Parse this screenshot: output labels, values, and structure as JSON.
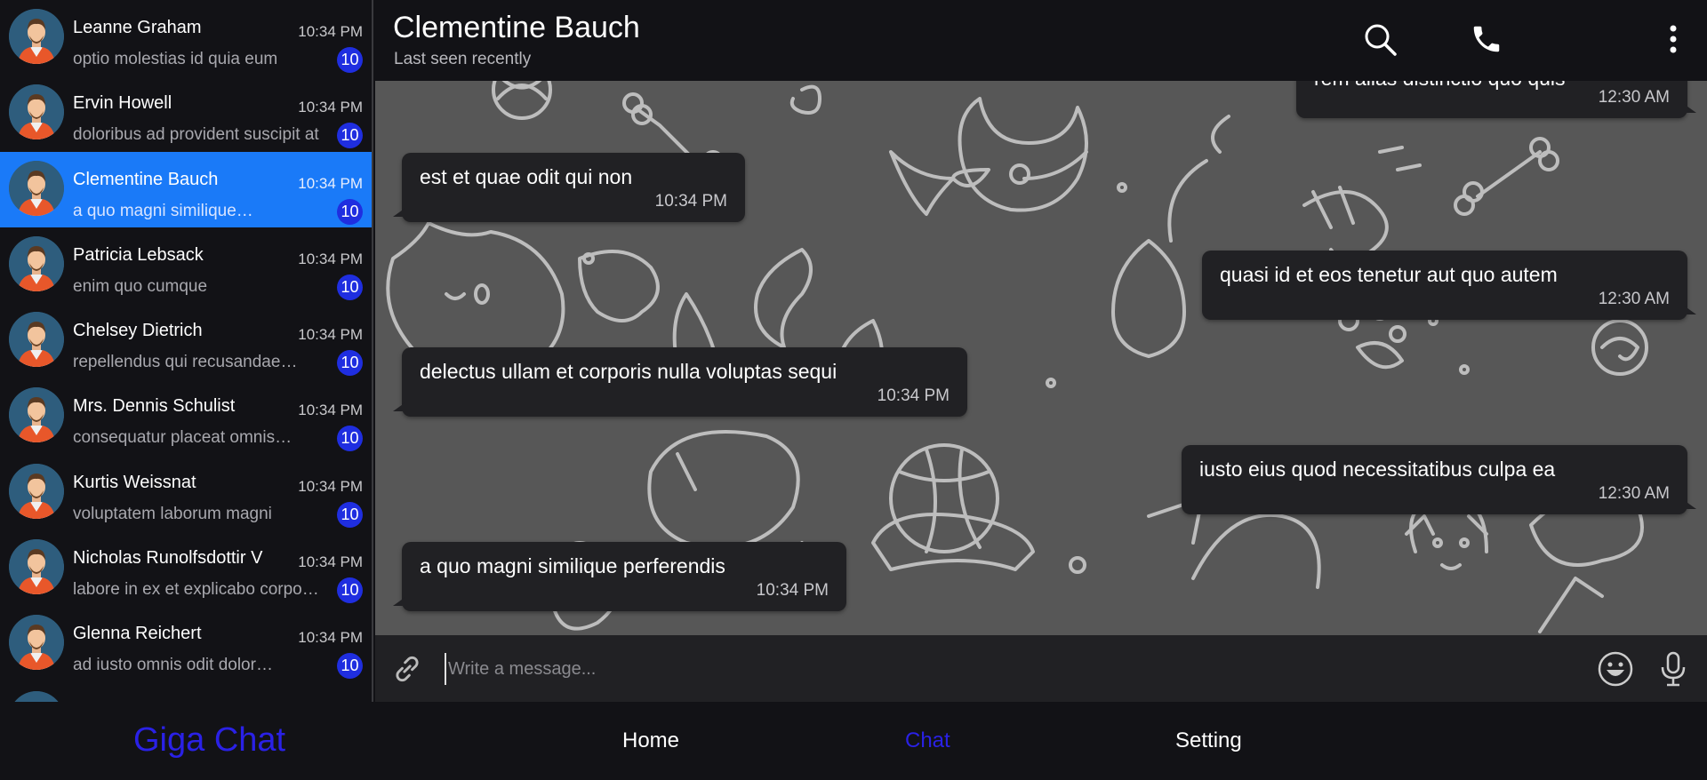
{
  "contacts": [
    {
      "name": "Leanne Graham",
      "time": "10:34 PM",
      "preview": "optio molestias id quia eum",
      "unread": "10"
    },
    {
      "name": "Ervin Howell",
      "time": "10:34 PM",
      "preview": "doloribus ad provident suscipit at",
      "unread": "10"
    },
    {
      "name": "Clementine Bauch",
      "time": "10:34 PM",
      "preview": "a quo magni similique…",
      "unread": "10"
    },
    {
      "name": "Patricia Lebsack",
      "time": "10:34 PM",
      "preview": "enim quo cumque",
      "unread": "10"
    },
    {
      "name": "Chelsey Dietrich",
      "time": "10:34 PM",
      "preview": "repellendus qui recusandae…",
      "unread": "10"
    },
    {
      "name": "Mrs. Dennis Schulist",
      "time": "10:34 PM",
      "preview": "consequatur placeat omnis…",
      "unread": "10"
    },
    {
      "name": "Kurtis Weissnat",
      "time": "10:34 PM",
      "preview": "voluptatem laborum magni",
      "unread": "10"
    },
    {
      "name": "Nicholas Runolfsdottir V",
      "time": "10:34 PM",
      "preview": "labore in ex et explicabo corpo…",
      "unread": "10"
    },
    {
      "name": "Glenna Reichert",
      "time": "10:34 PM",
      "preview": "ad iusto omnis odit dolor…",
      "unread": "10"
    }
  ],
  "active_contact": "Clementine Bauch",
  "header": {
    "title": "Clementine Bauch",
    "status": "Last seen recently",
    "icons": [
      "search-icon",
      "phone-icon",
      "more-vertical-icon"
    ]
  },
  "messages": [
    {
      "text": "rem alias distinctio quo quis",
      "time": "12:30 AM",
      "direction": "outgoing"
    },
    {
      "text": "est et quae odit qui non",
      "time": "10:34 PM",
      "direction": "incoming"
    },
    {
      "text": "quasi id et eos tenetur aut quo autem",
      "time": "12:30 AM",
      "direction": "outgoing"
    },
    {
      "text": "delectus ullam et corporis nulla voluptas sequi",
      "time": "10:34 PM",
      "direction": "incoming"
    },
    {
      "text": "iusto eius quod necessitatibus culpa ea",
      "time": "12:30 AM",
      "direction": "outgoing"
    },
    {
      "text": "a quo magni similique perferendis",
      "time": "10:34 PM",
      "direction": "incoming"
    }
  ],
  "composer": {
    "placeholder": "Write a message...",
    "icons": [
      "attach-icon",
      "emoji-icon",
      "microphone-icon"
    ]
  },
  "nav": {
    "brand": "Giga Chat",
    "items": [
      {
        "label": "Home",
        "active": false
      },
      {
        "label": "Chat",
        "active": true
      },
      {
        "label": "Setting",
        "active": false
      }
    ]
  },
  "colors": {
    "accent": "#1a7af8",
    "badge": "#1f2ee0",
    "brand": "#2a21e6",
    "background": "#121216",
    "chat_background": "#575757",
    "bubble": "#212124"
  }
}
